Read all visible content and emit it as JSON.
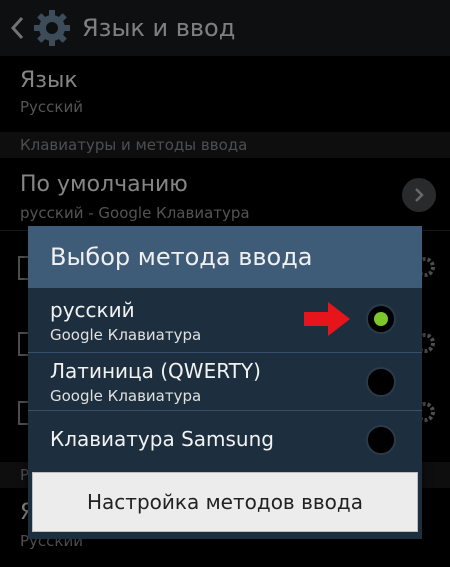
{
  "actionbar": {
    "title": "Язык и ввод"
  },
  "list": {
    "language_title": "Язык",
    "language_value": "Русский",
    "section_keyboards": "Клавиатуры и методы ввода",
    "default_title": "По умолчанию",
    "default_value": "русский - Google Клавиатура",
    "bottom_title_partial": "Я",
    "bottom_value": "Русский",
    "section_bottom_partial": "Р"
  },
  "dialog": {
    "title": "Выбор метода ввода",
    "options": [
      {
        "title": "русский",
        "subtitle": "Google Клавиатура",
        "selected": true
      },
      {
        "title": "Латиница (QWERTY)",
        "subtitle": "Google Клавиатура",
        "selected": false
      },
      {
        "title": "Клавиатура Samsung",
        "subtitle": "",
        "selected": false
      }
    ],
    "settings_button": "Настройка методов ввода"
  },
  "colors": {
    "dialog_bg": "#1d2f3e",
    "dialog_title_bg": "#3e5b77",
    "radio_selected": "#7ec72a",
    "arrow": "#e8141b"
  },
  "icons": [
    "back-arrow-icon",
    "settings-gear-icon",
    "chevron-right-icon",
    "red-arrow-icon"
  ]
}
